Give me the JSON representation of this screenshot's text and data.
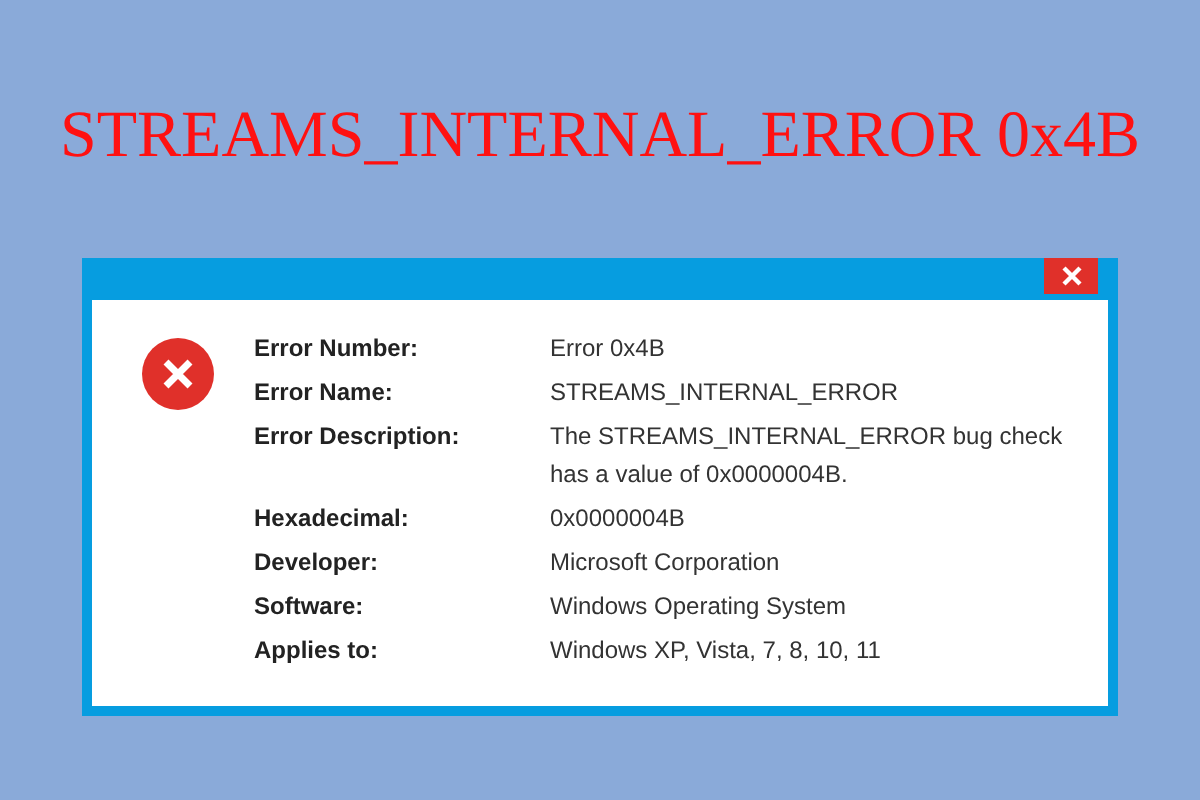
{
  "headline": "STREAMS_INTERNAL_ERROR 0x4B",
  "dialog": {
    "fields": [
      {
        "label": "Error Number:",
        "value": "Error 0x4B"
      },
      {
        "label": "Error Name:",
        "value": "STREAMS_INTERNAL_ERROR"
      },
      {
        "label": "Error Description:",
        "value": "The STREAMS_INTERNAL_ERROR bug check has a value of 0x0000004B."
      },
      {
        "label": "Hexadecimal:",
        "value": "0x0000004B"
      },
      {
        "label": "Developer:",
        "value": "Microsoft Corporation"
      },
      {
        "label": "Software:",
        "value": "Windows Operating System"
      },
      {
        "label": "Applies to:",
        "value": "Windows XP, Vista, 7, 8, 10, 11"
      }
    ]
  }
}
